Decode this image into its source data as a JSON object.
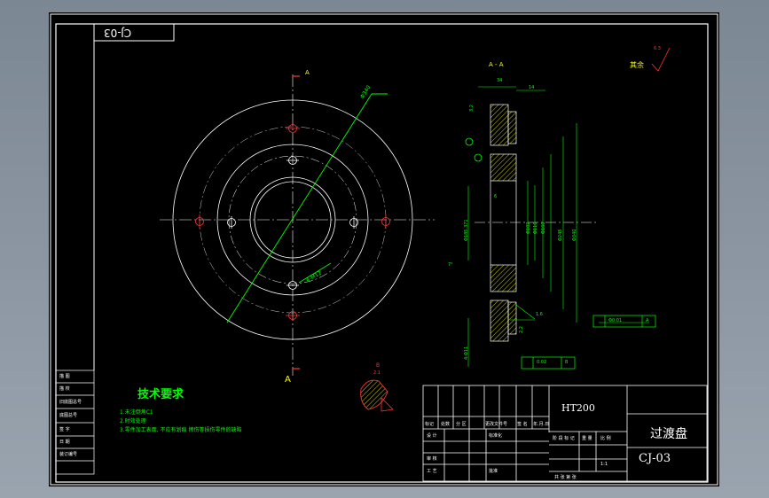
{
  "drawing": {
    "part_number_stamp": "CJ-03",
    "section_label": "A - A",
    "section_cut_top": "A",
    "section_cut_bottom": "A",
    "detail_label": "B",
    "detail_scale": "2:1",
    "roughness_other": "其余",
    "roughness_value": "6.3",
    "tech_title": "技术要求",
    "tech_items": [
      "1.未注倒角C1",
      "2.时效处理",
      "3.零件加工表面, 不应有划痕 擦伤等损伤零件的缺陷"
    ],
    "dims": {
      "d340": "Φ340",
      "holes": "4-M12",
      "d34": "34",
      "d14": "14",
      "r32": "3.2",
      "c6": "6",
      "d185": "Φ185.371",
      "d102": "Φ102",
      "d110": "Φ110",
      "d160": "Φ160",
      "d245": "Φ245",
      "d340b": "Φ340",
      "d112": "4-Φ11",
      "d22": "2.2",
      "angle": "7°",
      "small_1": "1.6",
      "tol_runout": "0.02",
      "tol_ref_b": "B",
      "tol_pos": "Φ0.01",
      "tol_ref_a": "A"
    },
    "left_block": [
      "描 图",
      "描 校",
      "旧底图总号",
      "底图总号",
      "签 字",
      "日 期",
      "装订编号"
    ]
  },
  "title_block": {
    "material": "HT200",
    "part_name": "过渡盘",
    "drawing_no": "CJ-03",
    "scale": "1:1",
    "headers": [
      "标记",
      "处数",
      "分 区",
      "更改文件号",
      "签 名",
      "年.月.日"
    ],
    "roles": [
      "设 计",
      "审 核",
      "工 艺"
    ],
    "std": "标准化",
    "approve": "批准",
    "stage_headers": [
      "阶 段 标 记",
      "重 量",
      "比 例"
    ],
    "sheet": "共 张 第 张"
  }
}
